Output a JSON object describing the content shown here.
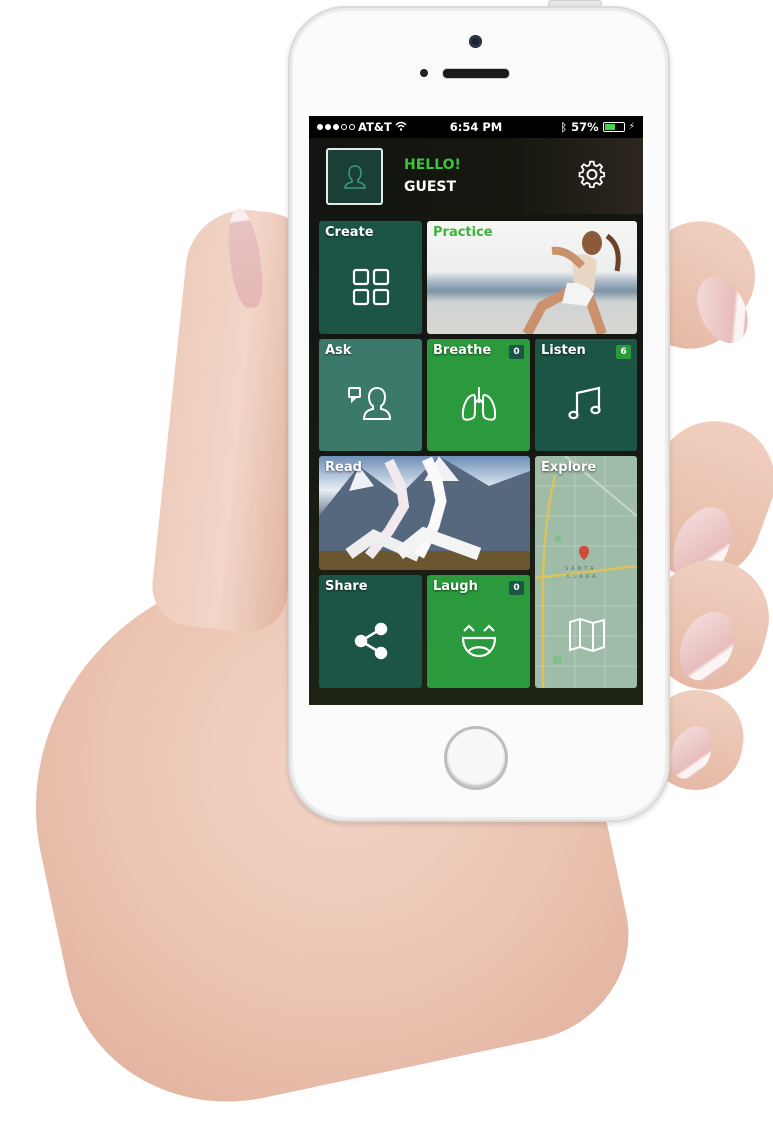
{
  "status_bar": {
    "carrier": "AT&T",
    "signal_bars_filled": 3,
    "signal_bars_total": 5,
    "time": "6:54 PM",
    "battery_percent": "57%",
    "battery_level": 0.57
  },
  "header": {
    "greeting": "HELLO!",
    "username": "GUEST",
    "avatar_icon": "user-icon",
    "settings_icon": "gear-icon"
  },
  "tiles": {
    "create": {
      "label": "Create",
      "icon": "grid-icon"
    },
    "practice": {
      "label": "Practice",
      "image": "woman-stretching-desert-photo"
    },
    "ask": {
      "label": "Ask",
      "icon": "ask-person-icon"
    },
    "breathe": {
      "label": "Breathe",
      "icon": "lungs-icon",
      "badge": "0"
    },
    "listen": {
      "label": "Listen",
      "icon": "music-note-icon",
      "badge": "6"
    },
    "read": {
      "label": "Read",
      "image": "yoga-mountains-photo"
    },
    "explore": {
      "label": "Explore",
      "icon": "map-icon",
      "map_label": "SANTA CLARA"
    },
    "share": {
      "label": "Share",
      "icon": "share-icon"
    },
    "laugh": {
      "label": "Laugh",
      "icon": "laughing-face-icon",
      "badge": "0"
    }
  },
  "colors": {
    "brand_green": "#2a9a3c",
    "dark_green": "#1c5546",
    "teal_green": "#3b7a6a",
    "hello_green": "#3cc43c"
  }
}
